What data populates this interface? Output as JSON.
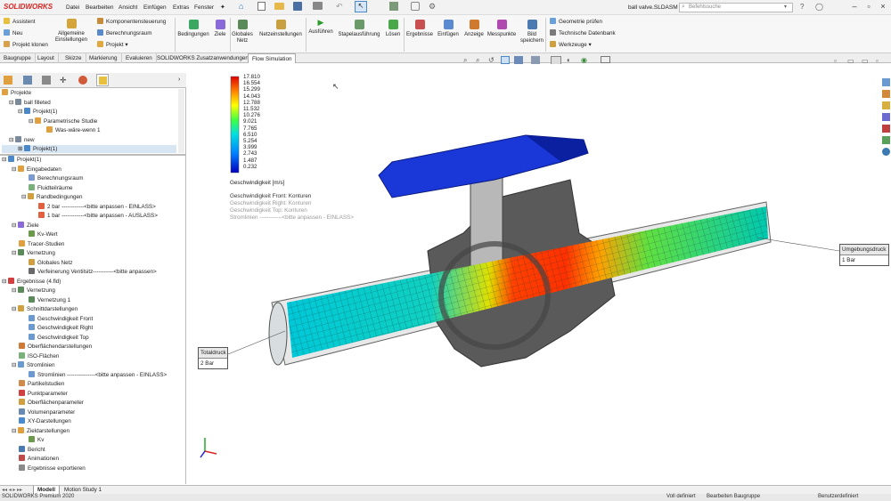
{
  "app": {
    "logo": "SOLIDWORKS",
    "document_title": "ball valve.SLDASM *",
    "search_placeholder": "Befehlssuche"
  },
  "menu": [
    "Datei",
    "Bearbeiten",
    "Ansicht",
    "Einfügen",
    "Extras",
    "Fenster"
  ],
  "ribbon": {
    "left": [
      "Assistent",
      "Neu",
      "Projekt klonen"
    ],
    "general": "Allgemeine Einstellungen",
    "mid": [
      "Komponentensteuerung",
      "Berechnungsraum",
      "Projekt"
    ],
    "buttons": [
      "Bedingungen",
      "Ziele",
      "Globales Netz",
      "Netzeinstellungen",
      "Ausführen",
      "Stapelausführung",
      "Lösen",
      "Ergebnisse",
      "Einfügen",
      "Anzeige",
      "Messpunkte",
      "Bild speichern"
    ],
    "right": [
      "Geometrie prüfen",
      "Technische Datenbank",
      "Werkzeuge"
    ]
  },
  "tabs": [
    "Baugruppe",
    "Layout",
    "Skizze",
    "Markierung",
    "Evaluieren",
    "SOLIDWORKS Zusatzanwendungen",
    "Flow Simulation"
  ],
  "active_tab": "Flow Simulation",
  "tree_top": [
    "Projekte",
    "ball filleted",
    "Projekt(1)",
    "Parametrische Studie",
    "Was-wäre-wenn 1",
    "new",
    "Projekt(1)"
  ],
  "tree": [
    "Projekt(1)",
    "Eingabedaten",
    "Berechnungsraum",
    "Fluidteilräume",
    "Randbedingungen",
    "2 bar ------------<bitte anpassen - EINLASS>",
    "1 bar ------------<bitte anpassen - AUSLASS>",
    "Ziele",
    "Kv-Wert",
    "Tracer-Studien",
    "Vernetzung",
    "Globales Netz",
    "Verfeinerung Ventilsitz-----------<bitte anpassen>",
    "Ergebnisse (4.fld)",
    "Vernetzung",
    "Vernetzung 1",
    "Schnittdarstellungen",
    "Geschwindigkeit Front",
    "Geschwindigkeit Right",
    "Geschwindigkeit Top",
    "Oberflächendarstellungen",
    "ISO-Flächen",
    "Stromlinien",
    "Stromlinien ---------------<bitte anpassen - EINLASS>",
    "Partikelstudien",
    "Punktparameter",
    "Oberflächenparameter",
    "Volumenparameter",
    "XY-Darstellungen",
    "Zieldarstellungen",
    "Kv",
    "Bericht",
    "Animationen",
    "Ergebnisse exportieren"
  ],
  "legend": {
    "values": [
      "17.810",
      "16.554",
      "15.299",
      "14.043",
      "12.788",
      "11.532",
      "10.276",
      "9.021",
      "7.765",
      "6.510",
      "5.254",
      "3.999",
      "2.743",
      "1.487",
      "0.232"
    ],
    "unit_label": "Geschwindigkeit [m/s]",
    "plots": [
      "Geschwindigkeit Front: Konturen",
      "Geschwindigkeit Right: Konturen",
      "Geschwindigkeit Top: Konturen",
      "Stromlinien ------------<bitte anpassen - EINLASS>"
    ]
  },
  "callouts": {
    "left": {
      "title": "Totaldruck",
      "value": "2 Bar"
    },
    "right": {
      "title": "Umgebungsdruck",
      "value": "1 Bar"
    }
  },
  "bottom_tabs": [
    "Modell",
    "Motion Study 1"
  ],
  "status": {
    "left": "SOLIDWORKS Premium 2020",
    "mid1": "Voll definiert",
    "mid2": "Bearbeiten Baugruppe",
    "right": "Benutzerdefiniert"
  }
}
